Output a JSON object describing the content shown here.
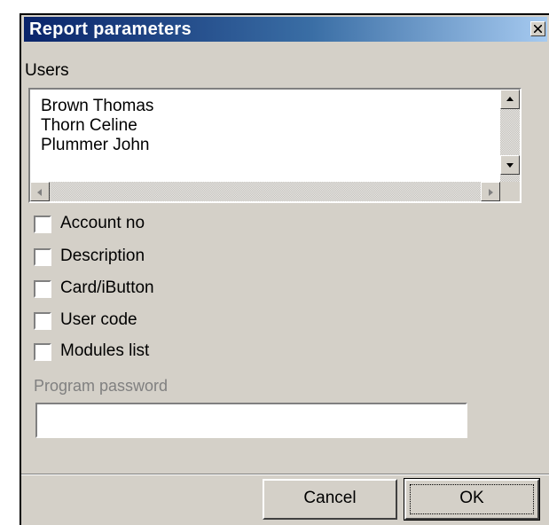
{
  "dialog": {
    "title": "Report parameters",
    "close_icon": "close-icon"
  },
  "users": {
    "label": "Users",
    "items": [
      "Brown Thomas",
      "Thorn Celine",
      "Plummer John"
    ],
    "scroll_icons": {
      "up": "scroll-up-arrow-icon",
      "down": "scroll-down-arrow-icon",
      "left": "scroll-left-arrow-icon",
      "right": "scroll-right-arrow-icon"
    }
  },
  "options": [
    {
      "label": "Account no",
      "checked": false
    },
    {
      "label": "Description",
      "checked": false
    },
    {
      "label": "Card/iButton",
      "checked": false
    },
    {
      "label": "User code",
      "checked": false
    },
    {
      "label": "Modules list",
      "checked": false
    }
  ],
  "password": {
    "label": "Program password",
    "value": "",
    "enabled": false
  },
  "buttons": {
    "cancel": "Cancel",
    "ok": "OK"
  },
  "colors": {
    "title_start": "#0a246a",
    "title_end": "#a6caf0",
    "face": "#d4d0c8",
    "disabled_text": "#808080"
  }
}
